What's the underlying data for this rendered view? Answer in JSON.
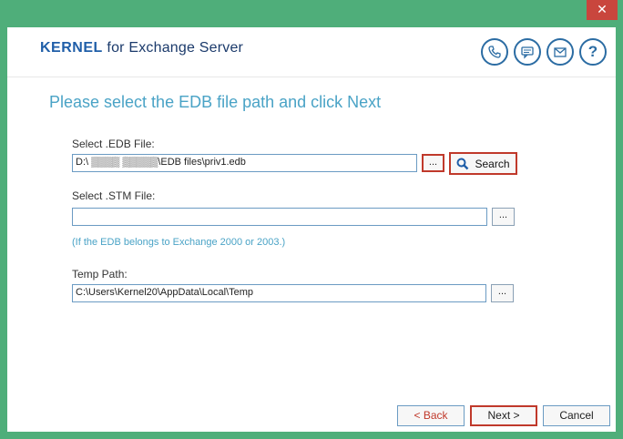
{
  "window": {
    "close_label": "✕"
  },
  "header": {
    "brand": "KERNEL",
    "product": " for Exchange Server"
  },
  "icons": [
    "phone-icon",
    "chat-icon",
    "mail-icon",
    "help-icon"
  ],
  "main": {
    "headline": "Please select the EDB file path and click Next",
    "edb": {
      "label": "Select .EDB File:",
      "value": "D:\\ ▒▒▒▒ ▒▒▒▒▒\\EDB files\\priv1.edb",
      "browse": "..."
    },
    "search_label": "Search",
    "stm": {
      "label": "Select .STM File:",
      "value": "",
      "browse": "..."
    },
    "note": "(If the EDB belongs to Exchange 2000 or 2003.)",
    "temp": {
      "label": "Temp Path:",
      "value": "C:\\Users\\Kernel20\\AppData\\Local\\Temp",
      "browse": "..."
    }
  },
  "footer": {
    "back": "< Back",
    "next": "Next >",
    "cancel": "Cancel"
  },
  "colors": {
    "frame": "#4fae7a",
    "accent": "#4aa3c6",
    "highlight": "#c0392b"
  }
}
